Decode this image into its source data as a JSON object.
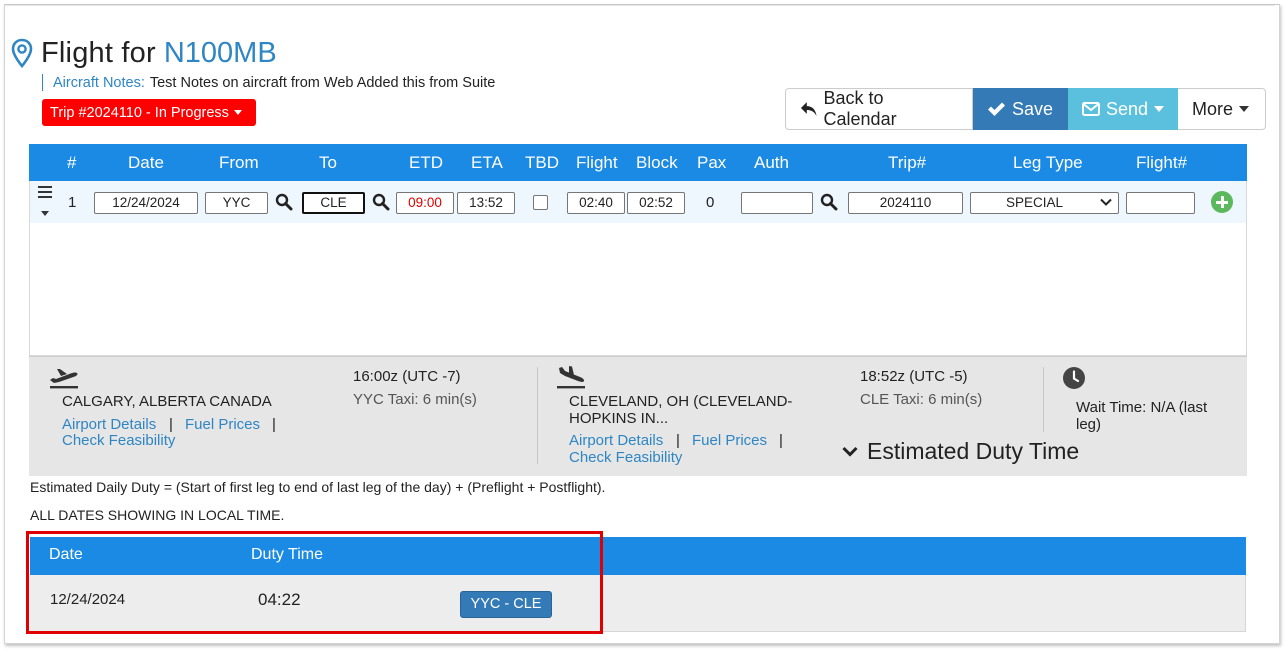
{
  "header": {
    "title_prefix": "Flight for",
    "tail_number": "N100MB",
    "notes_label": "Aircraft Notes:",
    "notes_value": "Test Notes on aircraft from Web Added this from Suite",
    "trip_badge": "Trip #2024110 - In Progress"
  },
  "toolbar": {
    "back_label": "Back to Calendar",
    "save_label": "Save",
    "send_label": "Send",
    "more_label": "More"
  },
  "legs_table": {
    "columns": [
      "#",
      "Date",
      "From",
      "To",
      "ETD",
      "ETA",
      "TBD",
      "Flight",
      "Block",
      "Pax",
      "Auth",
      "Trip#",
      "Leg Type",
      "Flight#"
    ],
    "row": {
      "num": "1",
      "date": "12/24/2024",
      "from": "YYC",
      "to": "CLE",
      "etd": "09:00",
      "eta": "13:52",
      "tbd": false,
      "flight": "02:40",
      "block": "02:52",
      "pax": "0",
      "auth": "",
      "trip": "2024110",
      "leg_type": "SPECIAL",
      "flight_no": ""
    }
  },
  "departure": {
    "city": "CALGARY, ALBERTA CANADA",
    "time": "16:00z (UTC -7)",
    "taxi": "YYC Taxi: 6 min(s)",
    "link_details": "Airport Details",
    "link_fuel": "Fuel Prices",
    "link_feasibility": "Check Feasibility",
    "separator": "|"
  },
  "arrival": {
    "city_line1": "CLEVELAND, OH (CLEVELAND-",
    "city_line2": "HOPKINS IN...",
    "time": "18:52z (UTC -5)",
    "taxi": "CLE Taxi: 6 min(s)",
    "link_details": "Airport Details",
    "link_fuel": "Fuel Prices",
    "link_feasibility": "Check Feasibility",
    "separator": "|"
  },
  "wait": {
    "line1": "Wait Time: N/A (last",
    "line2": "leg)"
  },
  "duty": {
    "toggle_label": "Estimated Duty Time",
    "formula": "Estimated Daily Duty = (Start of first leg to end of last leg of the day) + (Preflight + Postflight).",
    "dates_note": "ALL DATES SHOWING IN LOCAL TIME.",
    "columns": [
      "Date",
      "Duty Time"
    ],
    "rows": [
      {
        "date": "12/24/2024",
        "duty_time": "04:22",
        "legs": "YYC - CLE"
      }
    ]
  },
  "colors": {
    "accent_blue": "#1a8ae5",
    "link_blue": "#2e86c4",
    "save_blue": "#337ab7",
    "send_cyan": "#5bc0de",
    "trip_badge_red": "#ff0000",
    "add_green": "#5cb85c"
  },
  "icons": [
    "map-pin-icon",
    "back-arrow-icon",
    "check-icon",
    "envelope-icon",
    "search-icon",
    "hamburger-icon",
    "plus-circle-icon",
    "departure-plane-icon",
    "arrival-plane-icon",
    "clock-icon",
    "chevron-down-icon"
  ]
}
